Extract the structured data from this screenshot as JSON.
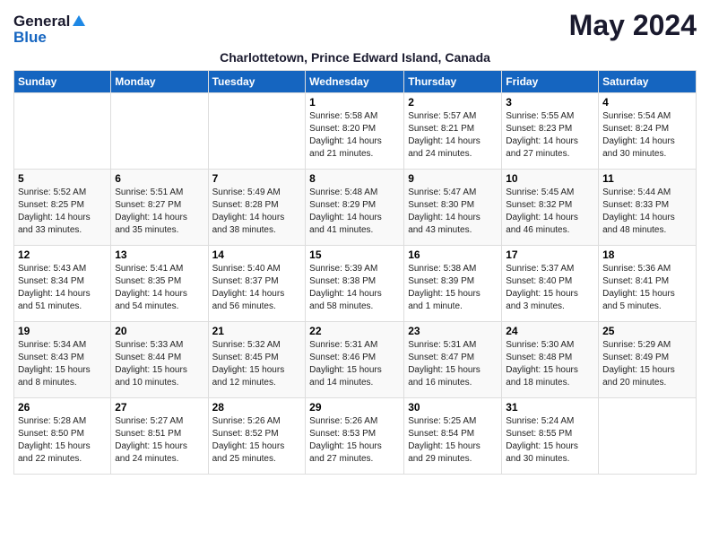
{
  "header": {
    "logo_general": "General",
    "logo_blue": "Blue",
    "month_title": "May 2024",
    "subtitle": "Charlottetown, Prince Edward Island, Canada"
  },
  "days_of_week": [
    "Sunday",
    "Monday",
    "Tuesday",
    "Wednesday",
    "Thursday",
    "Friday",
    "Saturday"
  ],
  "weeks": [
    [
      {
        "date": "",
        "lines": []
      },
      {
        "date": "",
        "lines": []
      },
      {
        "date": "",
        "lines": []
      },
      {
        "date": "1",
        "lines": [
          "Sunrise: 5:58 AM",
          "Sunset: 8:20 PM",
          "Daylight: 14 hours",
          "and 21 minutes."
        ]
      },
      {
        "date": "2",
        "lines": [
          "Sunrise: 5:57 AM",
          "Sunset: 8:21 PM",
          "Daylight: 14 hours",
          "and 24 minutes."
        ]
      },
      {
        "date": "3",
        "lines": [
          "Sunrise: 5:55 AM",
          "Sunset: 8:23 PM",
          "Daylight: 14 hours",
          "and 27 minutes."
        ]
      },
      {
        "date": "4",
        "lines": [
          "Sunrise: 5:54 AM",
          "Sunset: 8:24 PM",
          "Daylight: 14 hours",
          "and 30 minutes."
        ]
      }
    ],
    [
      {
        "date": "5",
        "lines": [
          "Sunrise: 5:52 AM",
          "Sunset: 8:25 PM",
          "Daylight: 14 hours",
          "and 33 minutes."
        ]
      },
      {
        "date": "6",
        "lines": [
          "Sunrise: 5:51 AM",
          "Sunset: 8:27 PM",
          "Daylight: 14 hours",
          "and 35 minutes."
        ]
      },
      {
        "date": "7",
        "lines": [
          "Sunrise: 5:49 AM",
          "Sunset: 8:28 PM",
          "Daylight: 14 hours",
          "and 38 minutes."
        ]
      },
      {
        "date": "8",
        "lines": [
          "Sunrise: 5:48 AM",
          "Sunset: 8:29 PM",
          "Daylight: 14 hours",
          "and 41 minutes."
        ]
      },
      {
        "date": "9",
        "lines": [
          "Sunrise: 5:47 AM",
          "Sunset: 8:30 PM",
          "Daylight: 14 hours",
          "and 43 minutes."
        ]
      },
      {
        "date": "10",
        "lines": [
          "Sunrise: 5:45 AM",
          "Sunset: 8:32 PM",
          "Daylight: 14 hours",
          "and 46 minutes."
        ]
      },
      {
        "date": "11",
        "lines": [
          "Sunrise: 5:44 AM",
          "Sunset: 8:33 PM",
          "Daylight: 14 hours",
          "and 48 minutes."
        ]
      }
    ],
    [
      {
        "date": "12",
        "lines": [
          "Sunrise: 5:43 AM",
          "Sunset: 8:34 PM",
          "Daylight: 14 hours",
          "and 51 minutes."
        ]
      },
      {
        "date": "13",
        "lines": [
          "Sunrise: 5:41 AM",
          "Sunset: 8:35 PM",
          "Daylight: 14 hours",
          "and 54 minutes."
        ]
      },
      {
        "date": "14",
        "lines": [
          "Sunrise: 5:40 AM",
          "Sunset: 8:37 PM",
          "Daylight: 14 hours",
          "and 56 minutes."
        ]
      },
      {
        "date": "15",
        "lines": [
          "Sunrise: 5:39 AM",
          "Sunset: 8:38 PM",
          "Daylight: 14 hours",
          "and 58 minutes."
        ]
      },
      {
        "date": "16",
        "lines": [
          "Sunrise: 5:38 AM",
          "Sunset: 8:39 PM",
          "Daylight: 15 hours",
          "and 1 minute."
        ]
      },
      {
        "date": "17",
        "lines": [
          "Sunrise: 5:37 AM",
          "Sunset: 8:40 PM",
          "Daylight: 15 hours",
          "and 3 minutes."
        ]
      },
      {
        "date": "18",
        "lines": [
          "Sunrise: 5:36 AM",
          "Sunset: 8:41 PM",
          "Daylight: 15 hours",
          "and 5 minutes."
        ]
      }
    ],
    [
      {
        "date": "19",
        "lines": [
          "Sunrise: 5:34 AM",
          "Sunset: 8:43 PM",
          "Daylight: 15 hours",
          "and 8 minutes."
        ]
      },
      {
        "date": "20",
        "lines": [
          "Sunrise: 5:33 AM",
          "Sunset: 8:44 PM",
          "Daylight: 15 hours",
          "and 10 minutes."
        ]
      },
      {
        "date": "21",
        "lines": [
          "Sunrise: 5:32 AM",
          "Sunset: 8:45 PM",
          "Daylight: 15 hours",
          "and 12 minutes."
        ]
      },
      {
        "date": "22",
        "lines": [
          "Sunrise: 5:31 AM",
          "Sunset: 8:46 PM",
          "Daylight: 15 hours",
          "and 14 minutes."
        ]
      },
      {
        "date": "23",
        "lines": [
          "Sunrise: 5:31 AM",
          "Sunset: 8:47 PM",
          "Daylight: 15 hours",
          "and 16 minutes."
        ]
      },
      {
        "date": "24",
        "lines": [
          "Sunrise: 5:30 AM",
          "Sunset: 8:48 PM",
          "Daylight: 15 hours",
          "and 18 minutes."
        ]
      },
      {
        "date": "25",
        "lines": [
          "Sunrise: 5:29 AM",
          "Sunset: 8:49 PM",
          "Daylight: 15 hours",
          "and 20 minutes."
        ]
      }
    ],
    [
      {
        "date": "26",
        "lines": [
          "Sunrise: 5:28 AM",
          "Sunset: 8:50 PM",
          "Daylight: 15 hours",
          "and 22 minutes."
        ]
      },
      {
        "date": "27",
        "lines": [
          "Sunrise: 5:27 AM",
          "Sunset: 8:51 PM",
          "Daylight: 15 hours",
          "and 24 minutes."
        ]
      },
      {
        "date": "28",
        "lines": [
          "Sunrise: 5:26 AM",
          "Sunset: 8:52 PM",
          "Daylight: 15 hours",
          "and 25 minutes."
        ]
      },
      {
        "date": "29",
        "lines": [
          "Sunrise: 5:26 AM",
          "Sunset: 8:53 PM",
          "Daylight: 15 hours",
          "and 27 minutes."
        ]
      },
      {
        "date": "30",
        "lines": [
          "Sunrise: 5:25 AM",
          "Sunset: 8:54 PM",
          "Daylight: 15 hours",
          "and 29 minutes."
        ]
      },
      {
        "date": "31",
        "lines": [
          "Sunrise: 5:24 AM",
          "Sunset: 8:55 PM",
          "Daylight: 15 hours",
          "and 30 minutes."
        ]
      },
      {
        "date": "",
        "lines": []
      }
    ]
  ]
}
